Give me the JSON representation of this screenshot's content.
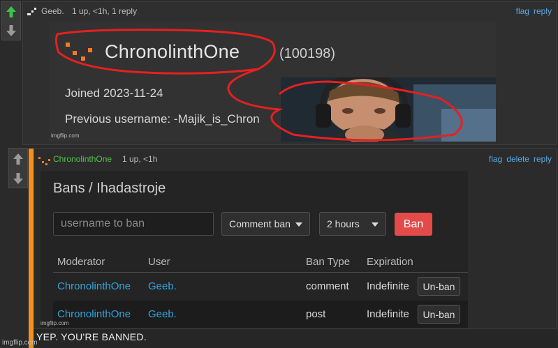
{
  "comment1": {
    "author": "Geeb.",
    "meta": "1 up, <1h, 1 reply",
    "actions": [
      "flag",
      "reply"
    ],
    "image": {
      "profile_name": "ChronolinthOne",
      "points": "(100198)",
      "joined": "Joined 2023-11-24",
      "previous": "Previous username: -Majik_is_Chron",
      "watermark": "imgflip.com"
    },
    "colors": {
      "upvote": "#3cc24b",
      "scribble": "#e62020"
    }
  },
  "comment2": {
    "author": "ChronolinthOne",
    "meta": "1 up, <1h",
    "actions": [
      "flag",
      "delete",
      "reply"
    ],
    "panel": {
      "title": "Bans / Ihadastroje",
      "input_placeholder": "username to ban",
      "type_select": "Comment ban",
      "duration_select": "2 hours",
      "ban_button": "Ban",
      "columns": [
        "Moderator",
        "User",
        "Ban Type",
        "Expiration"
      ],
      "rows": [
        {
          "moderator": "ChronolinthOne",
          "user": "Geeb.",
          "type": "comment",
          "expiration": "Indefinite",
          "action": "Un-ban"
        },
        {
          "moderator": "ChronolinthOne",
          "user": "Geeb.",
          "type": "post",
          "expiration": "Indefinite",
          "action": "Un-ban"
        }
      ]
    },
    "image_watermark": "imgflip.com",
    "caption": "YEP. YOU'RE BANNED.",
    "accent": "#f4901e"
  },
  "page_watermark": "imgflip.com"
}
